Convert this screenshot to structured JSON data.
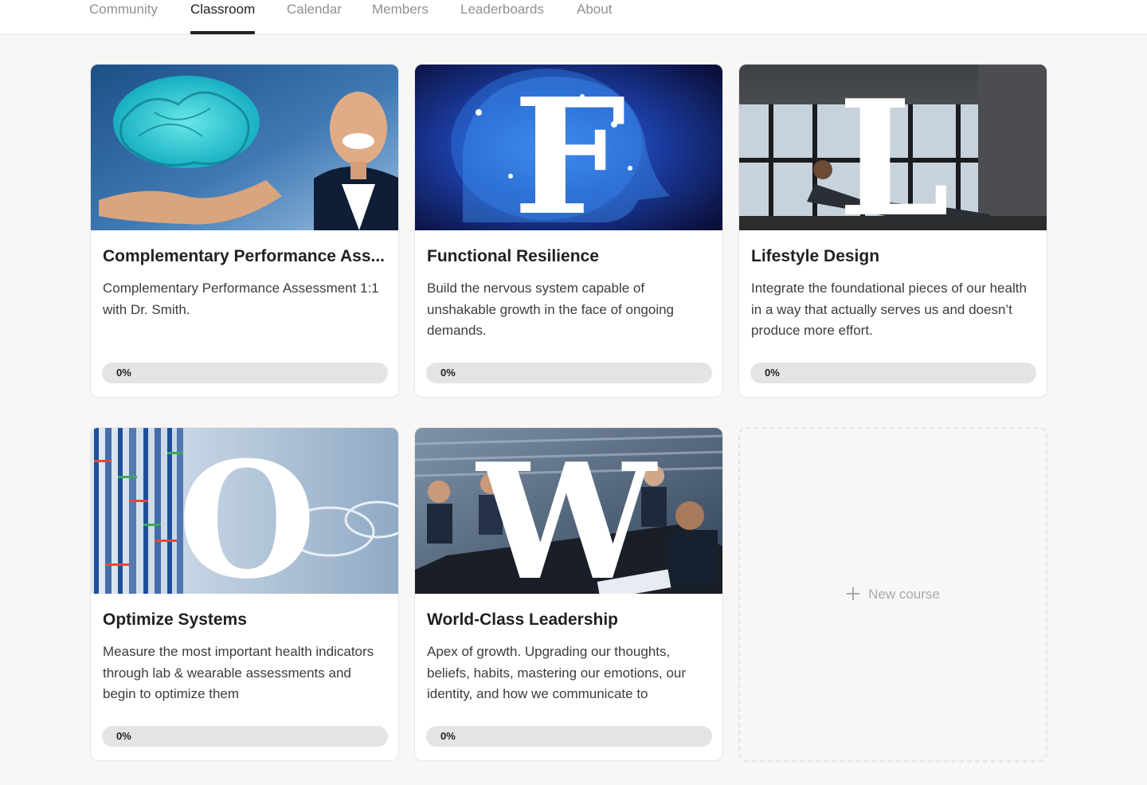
{
  "nav": {
    "tabs": [
      {
        "label": "Community"
      },
      {
        "label": "Classroom"
      },
      {
        "label": "Calendar"
      },
      {
        "label": "Members"
      },
      {
        "label": "Leaderboards"
      },
      {
        "label": "About"
      }
    ],
    "active_tab": "Classroom"
  },
  "courses": [
    {
      "title": "Complementary Performance Ass...",
      "description": "Complementary Performance Assessment 1:1 with Dr. Smith.",
      "progress_label": "0%",
      "progress": 0
    },
    {
      "title": "Functional Resilience",
      "description": "Build the nervous system capable of unshakable growth in the face of ongoing demands.",
      "progress_label": "0%",
      "progress": 0,
      "thumb_letter": "F"
    },
    {
      "title": "Lifestyle Design",
      "description": "Integrate the foundational pieces of our health in a way that actually serves us and doesn’t produce more effort.",
      "progress_label": "0%",
      "progress": 0,
      "thumb_letter": "L"
    },
    {
      "title": "Optimize Systems",
      "description": "Measure the most important health indicators through lab & wearable assessments and begin to optimize them",
      "progress_label": "0%",
      "progress": 0,
      "thumb_letter": "O"
    },
    {
      "title": "World-Class Leadership",
      "description": "Apex of growth. Upgrading our thoughts, beliefs, habits, mastering our emotions, our identity, and how we communicate to",
      "progress_label": "0%",
      "progress": 0,
      "thumb_letter": "W"
    }
  ],
  "new_course": {
    "label": "New course",
    "icon": "plus-icon"
  },
  "colors": {
    "page_bg": "#f8f7f5",
    "active_tab": "#202124",
    "inactive_tab": "#909090",
    "progress_track": "#e4e4e4"
  }
}
